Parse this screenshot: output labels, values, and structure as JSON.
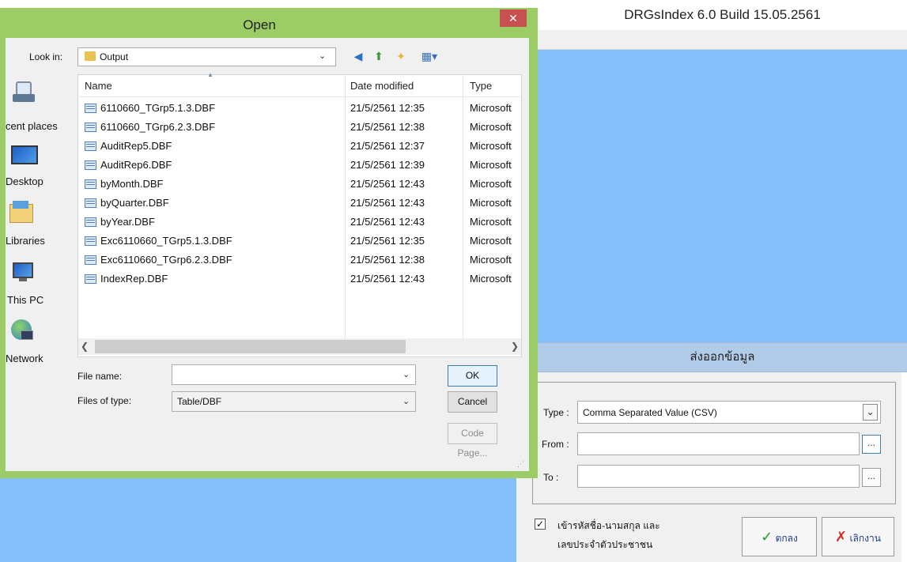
{
  "background_app": {
    "title": "DRGsIndex 6.0 Build 15.05.2561",
    "export_panel": {
      "header": "ส่งออกข้อมูล",
      "type_label": "Type :",
      "type_value": "Comma Separated Value (CSV)",
      "from_label": "From :",
      "from_value": "",
      "to_label": "To :",
      "to_value": "",
      "browse_label": "...",
      "checkbox_checked": true,
      "checkbox_label_line1": "เข้ารหัสชื่อ-นามสกุล และ",
      "checkbox_label_line2": "เลขประจำตัวประชาชน",
      "ok_label": "ตกลง",
      "cancel_label": "เลิกงาน"
    }
  },
  "dialog": {
    "title": "Open",
    "close_glyph": "✕",
    "look_in_label": "Look in:",
    "look_in_value": "Output",
    "places": [
      {
        "label": "cent places",
        "icon": "recent-places-icon"
      },
      {
        "label": "Desktop",
        "icon": "desktop-icon"
      },
      {
        "label": "Libraries",
        "icon": "libraries-icon"
      },
      {
        "label": "This PC",
        "icon": "this-pc-icon"
      },
      {
        "label": "Network",
        "icon": "network-icon"
      }
    ],
    "columns": [
      "Name",
      "Date modified",
      "Type"
    ],
    "files": [
      {
        "name": "6110660_TGrp5.1.3.DBF",
        "date": "21/5/2561 12:35",
        "type": "Microsoft"
      },
      {
        "name": "6110660_TGrp6.2.3.DBF",
        "date": "21/5/2561 12:38",
        "type": "Microsoft"
      },
      {
        "name": "AuditRep5.DBF",
        "date": "21/5/2561 12:37",
        "type": "Microsoft"
      },
      {
        "name": "AuditRep6.DBF",
        "date": "21/5/2561 12:39",
        "type": "Microsoft"
      },
      {
        "name": "byMonth.DBF",
        "date": "21/5/2561 12:43",
        "type": "Microsoft"
      },
      {
        "name": "byQuarter.DBF",
        "date": "21/5/2561 12:43",
        "type": "Microsoft"
      },
      {
        "name": "byYear.DBF",
        "date": "21/5/2561 12:43",
        "type": "Microsoft"
      },
      {
        "name": "Exc6110660_TGrp5.1.3.DBF",
        "date": "21/5/2561 12:35",
        "type": "Microsoft"
      },
      {
        "name": "Exc6110660_TGrp6.2.3.DBF",
        "date": "21/5/2561 12:38",
        "type": "Microsoft"
      },
      {
        "name": "IndexRep.DBF",
        "date": "21/5/2561 12:43",
        "type": "Microsoft"
      }
    ],
    "file_name_label": "File name:",
    "file_name_value": "",
    "files_of_type_label": "Files of type:",
    "files_of_type_value": "Table/DBF",
    "ok_label": "OK",
    "cancel_label": "Cancel",
    "code_page_label": "Code Page..."
  },
  "colors": {
    "dialog_frame": "#9ccc66",
    "app_background": "#85bff9",
    "close_button": "#c75050"
  }
}
